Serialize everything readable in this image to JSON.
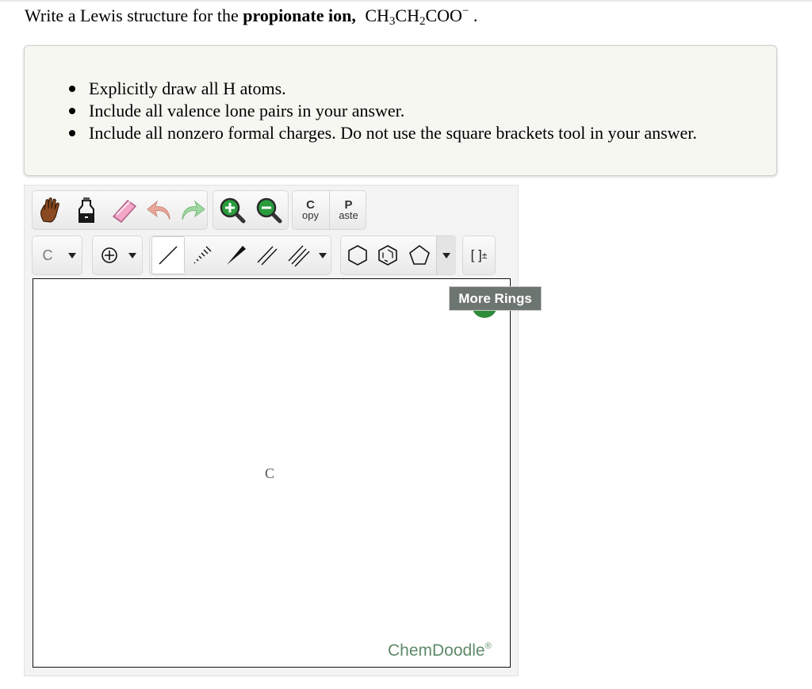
{
  "question": {
    "prefix": "Write a Lewis structure for the",
    "bold": "propionate ion,",
    "formula": {
      "p1": "CH",
      "s1": "3",
      "p2": "CH",
      "s2": "2",
      "p3": "COO",
      "sup": "−",
      "end": " ."
    }
  },
  "instructions": [
    "Explicitly draw all H atoms.",
    "Include all valence lone pairs in your answer.",
    "Include all nonzero formal charges. Do not use the square brackets tool in your answer."
  ],
  "toolbar": {
    "copy_top": "C",
    "copy_bottom": "opy",
    "paste_top": "P",
    "paste_bottom": "aste",
    "element_label": "C",
    "brackets_label": "[ ]",
    "brackets_charge": "±"
  },
  "icons": {
    "hand": "hand-icon",
    "erase_bottle": "clear-bottle-icon",
    "eraser": "eraser-icon",
    "undo": "undo-icon",
    "redo": "redo-icon",
    "zoom_in": "zoom-in-icon",
    "zoom_out": "zoom-out-icon",
    "charge": "charge-plus-icon",
    "single": "single-bond-icon",
    "stereo_dash": "dashed-bond-icon",
    "wedge": "wedge-bond-icon",
    "double": "double-bond-icon",
    "triple": "triple-bond-icon",
    "cyclohexane": "cyclohexane-icon",
    "benzene": "benzene-icon",
    "cyclopentane": "cyclopentane-icon"
  },
  "canvas": {
    "atom_label": "C",
    "tooltip": "More Rings",
    "brand": "ChemDoodle",
    "brand_mark": "®"
  },
  "colors": {
    "brand": "#5e8a68",
    "tooltip_bg": "#6d7570",
    "panel_bg": "#f7f7f2"
  }
}
